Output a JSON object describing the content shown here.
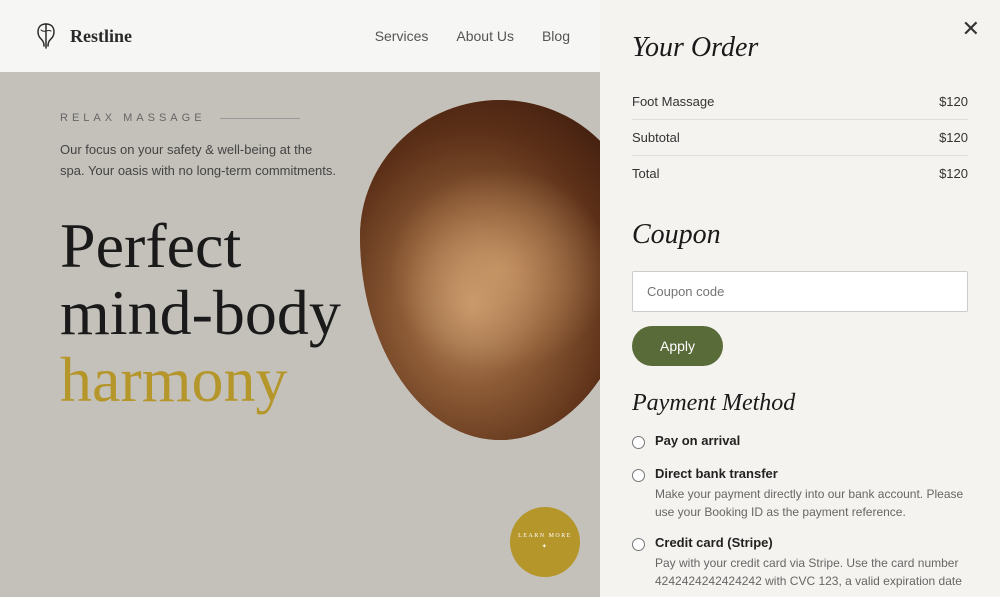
{
  "site": {
    "logo_text": "Restline",
    "nav": {
      "services": "Services",
      "about_us": "About Us",
      "blog": "Blog",
      "blog_has_dropdown": true
    },
    "hero": {
      "label": "RELAX MASSAGE",
      "description": "Our focus on your safety & well-being at the spa. Your oasis with no long-term commitments.",
      "title_line1": "Perfect",
      "title_line2": "mind-body",
      "title_line3": "harmony",
      "badge_text": "LEARN MORE"
    }
  },
  "order_panel": {
    "close_icon": "✕",
    "title": "Your Order",
    "items": [
      {
        "name": "Foot Massage",
        "price": "$120"
      }
    ],
    "subtotal_label": "Subtotal",
    "subtotal_value": "$120",
    "total_label": "Total",
    "total_value": "$120",
    "coupon": {
      "title": "Coupon",
      "placeholder": "Coupon code",
      "apply_label": "Apply"
    },
    "payment": {
      "title": "Payment Method",
      "options": [
        {
          "id": "pay-arrival",
          "label": "Pay on arrival",
          "description": ""
        },
        {
          "id": "bank-transfer",
          "label": "Direct bank transfer",
          "description": "Make your payment directly into our bank account. Please use your Booking ID as the payment reference."
        },
        {
          "id": "credit-card",
          "label": "Credit card (Stripe)",
          "description": "Pay with your credit card via Stripe. Use the card number 4242424242424242 with CVC 123, a valid expiration date"
        }
      ]
    }
  }
}
